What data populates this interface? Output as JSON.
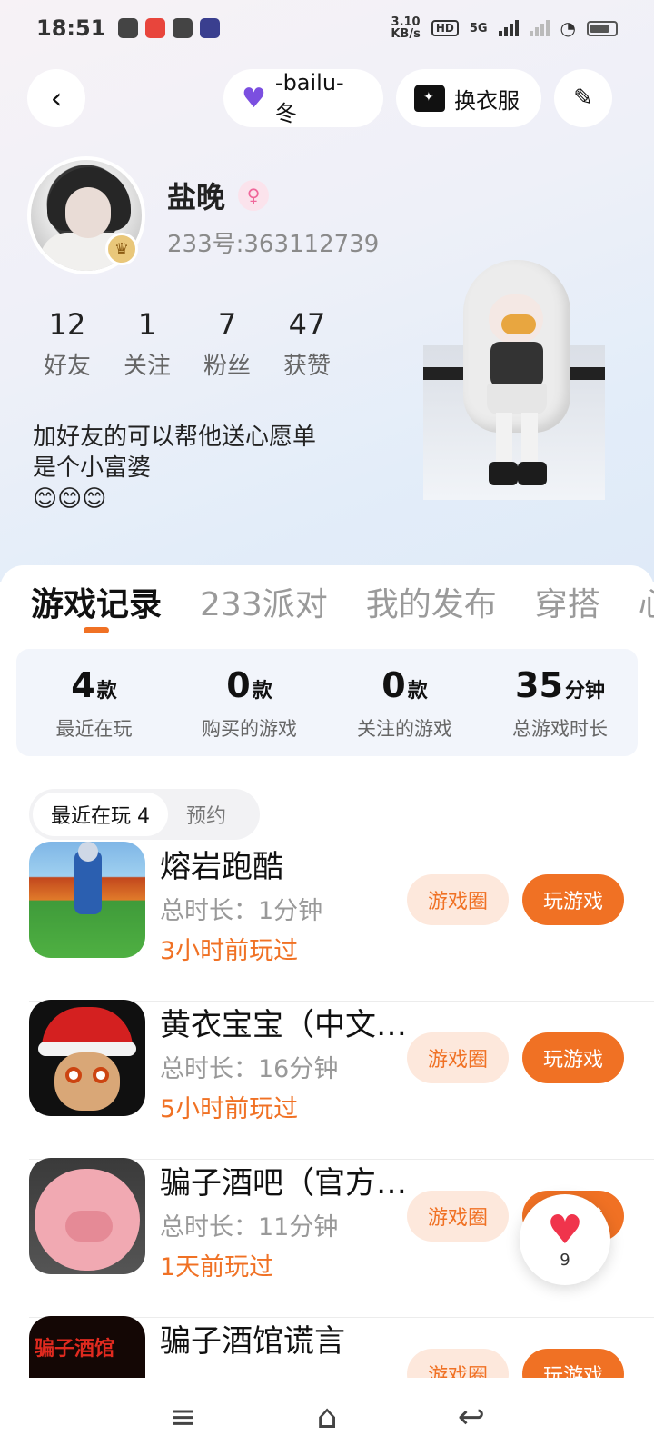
{
  "status_bar": {
    "time": "18:51",
    "net_speed_value": "3.10",
    "net_speed_unit": "KB/s",
    "hd_label": "HD",
    "network_label": "5G"
  },
  "header": {
    "back_icon": "chevron-left-icon",
    "friend_name": "-bailu-冬",
    "change_outfit_label": "换衣服",
    "edit_icon": "pencil-icon"
  },
  "profile": {
    "nickname": "盐晚",
    "gender_icon": "female-icon",
    "uid": "233号:363112739",
    "stats": [
      {
        "value": "12",
        "label": "好友"
      },
      {
        "value": "1",
        "label": "关注"
      },
      {
        "value": "7",
        "label": "粉丝"
      },
      {
        "value": "47",
        "label": "获赞"
      }
    ],
    "bio_lines": [
      "加好友的可以帮他送心愿单",
      "是个小富婆",
      "😊😊😊"
    ]
  },
  "tabs": [
    "游戏记录",
    "233派对",
    "我的发布",
    "穿搭",
    "心"
  ],
  "summary": [
    {
      "value": "4",
      "unit": "款",
      "label": "最近在玩"
    },
    {
      "value": "0",
      "unit": "款",
      "label": "购买的游戏"
    },
    {
      "value": "0",
      "unit": "款",
      "label": "关注的游戏"
    },
    {
      "value": "35",
      "unit": "分钟",
      "label": "总游戏时长"
    }
  ],
  "segment": {
    "recent_label": "最近在玩 4",
    "reserve_label": "预约"
  },
  "games": [
    {
      "name": "熔岩跑酷",
      "duration": "总时长：1分钟",
      "last_played": "3小时前玩过",
      "circle_label": "游戏圈",
      "play_label": "玩游戏"
    },
    {
      "name": "黄衣宝宝（中文…",
      "duration": "总时长：16分钟",
      "last_played": "5小时前玩过",
      "circle_label": "游戏圈",
      "play_label": "玩游戏"
    },
    {
      "name": "骗子酒吧（官方…",
      "duration": "总时长：11分钟",
      "last_played": "1天前玩过",
      "circle_label": "游戏圈",
      "play_label": "玩游戏"
    },
    {
      "name": "骗子酒馆谎言",
      "duration": "",
      "last_played": "",
      "circle_label": "游戏圈",
      "play_label": "玩游戏"
    }
  ],
  "tavern_icon_text": "骗子酒馆",
  "like_fab": {
    "count": "9"
  },
  "colors": {
    "accent": "#f07124",
    "accent_light": "#fde8dc",
    "heart": "#f0344c"
  }
}
